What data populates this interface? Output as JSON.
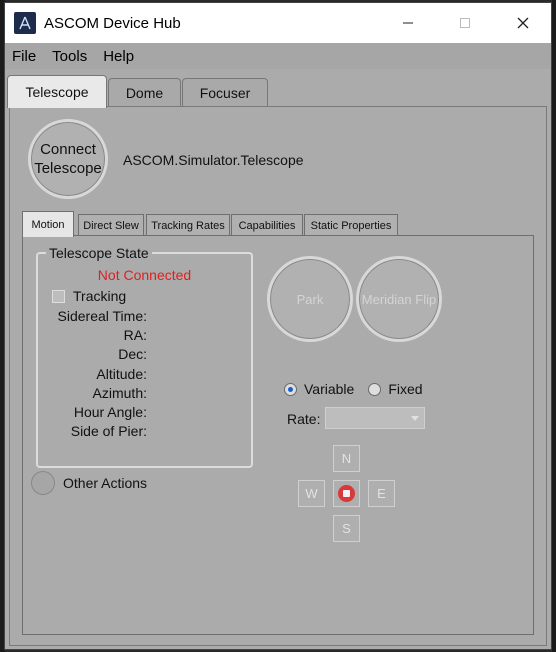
{
  "window": {
    "title": "ASCOM Device Hub",
    "controls": {
      "minimize": "—",
      "maximize": "☐",
      "close": "✕"
    }
  },
  "menu": {
    "items": [
      "File",
      "Tools",
      "Help"
    ]
  },
  "device_tabs": [
    "Telescope",
    "Dome",
    "Focuser"
  ],
  "telescope": {
    "connect_label": "Connect Telescope",
    "device_name": "ASCOM.Simulator.Telescope"
  },
  "function_tabs": [
    "Motion",
    "Direct Slew",
    "Tracking Rates",
    "Capabilities",
    "Static Properties"
  ],
  "state": {
    "group_title": "Telescope State",
    "status": "Not Connected",
    "tracking_label": "Tracking",
    "labels": [
      "Sidereal Time:",
      "RA:",
      "Dec:",
      "Altitude:",
      "Azimuth:",
      "Hour Angle:",
      "Side of Pier:"
    ]
  },
  "other_actions": "Other Actions",
  "buttons": {
    "park": "Park",
    "meridian_flip": "Meridian Flip"
  },
  "slew": {
    "variable_label": "Variable",
    "fixed_label": "Fixed",
    "rate_label": "Rate:",
    "rate_value": "",
    "north": "N",
    "south": "S",
    "east": "E",
    "west": "W"
  },
  "colors": {
    "status_red": "#e02020",
    "radio_selected": "#1a5fd0",
    "stop": "#d63a3a"
  }
}
